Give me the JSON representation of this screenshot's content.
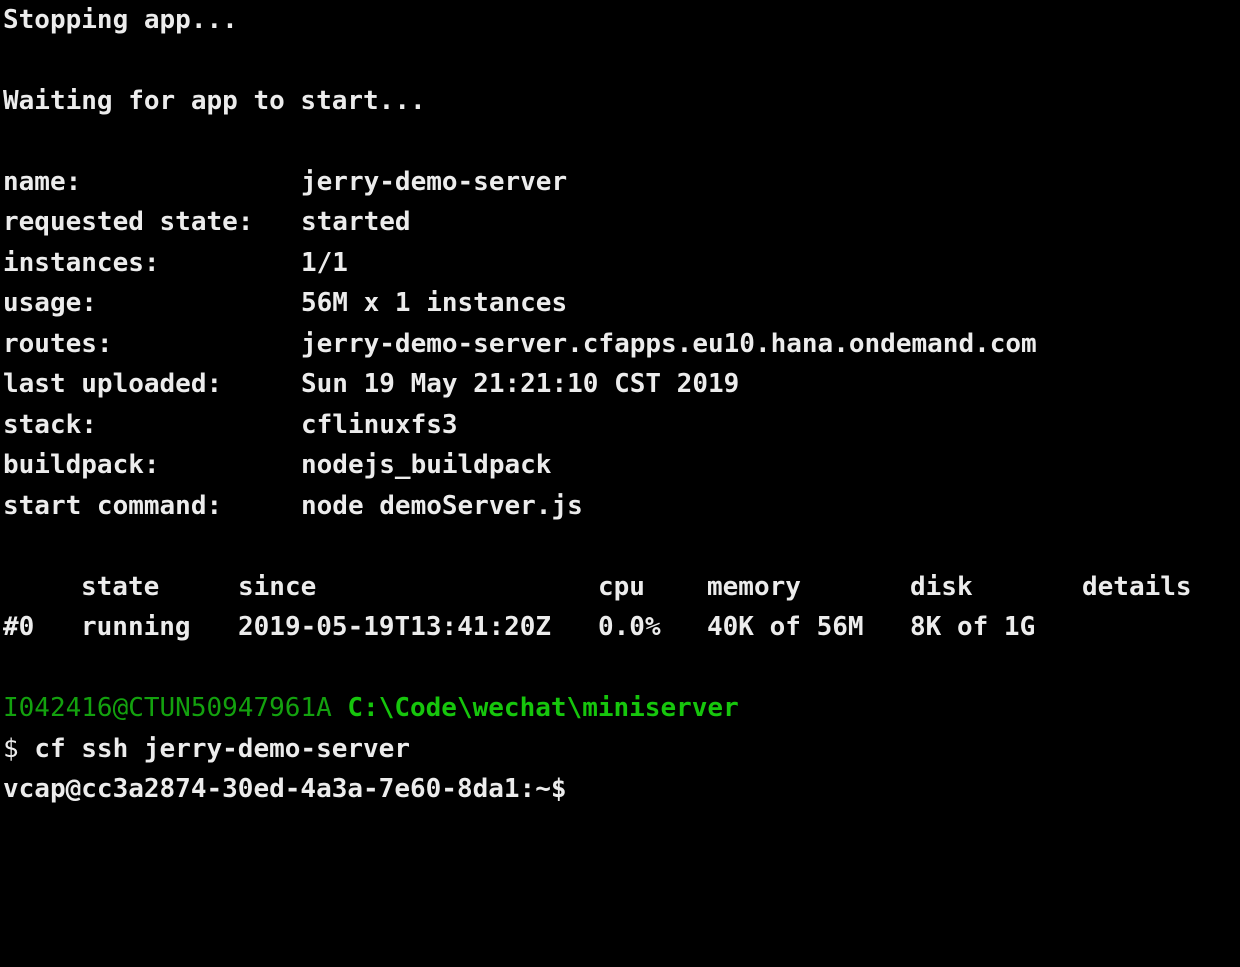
{
  "terminal": {
    "messages": {
      "stopping": "Stopping app...",
      "waiting": "Waiting for app to start..."
    },
    "app_info": [
      {
        "key": "name:",
        "value": "jerry-demo-server"
      },
      {
        "key": "requested state:",
        "value": "started"
      },
      {
        "key": "instances:",
        "value": "1/1"
      },
      {
        "key": "usage:",
        "value": "56M x 1 instances"
      },
      {
        "key": "routes:",
        "value": "jerry-demo-server.cfapps.eu10.hana.ondemand.com"
      },
      {
        "key": "last uploaded:",
        "value": "Sun 19 May 21:21:10 CST 2019"
      },
      {
        "key": "stack:",
        "value": "cflinuxfs3"
      },
      {
        "key": "buildpack:",
        "value": "nodejs_buildpack"
      },
      {
        "key": "start command:",
        "value": "node demoServer.js"
      }
    ],
    "instance_table": {
      "headers": {
        "state": "state",
        "since": "since",
        "cpu": "cpu",
        "memory": "memory",
        "disk": "disk",
        "details": "details"
      },
      "rows": [
        {
          "index": "#0",
          "state": "running",
          "since": "2019-05-19T13:41:20Z",
          "cpu": "0.0%",
          "memory": "40K of 56M",
          "disk": "8K of 1G",
          "details": ""
        }
      ]
    },
    "prompt": {
      "user_host": "I042416@CTUN50947961A",
      "path": "C:\\Code\\wechat\\miniserver",
      "command_symbol": "$",
      "command": "cf ssh jerry-demo-server",
      "remote_prompt": "vcap@cc3a2874-30ed-4a3a-7e60-8da1:~$"
    },
    "colors": {
      "background": "#000000",
      "text": "#ececec",
      "user_host": "#13a10e",
      "path": "#16c60c"
    }
  }
}
